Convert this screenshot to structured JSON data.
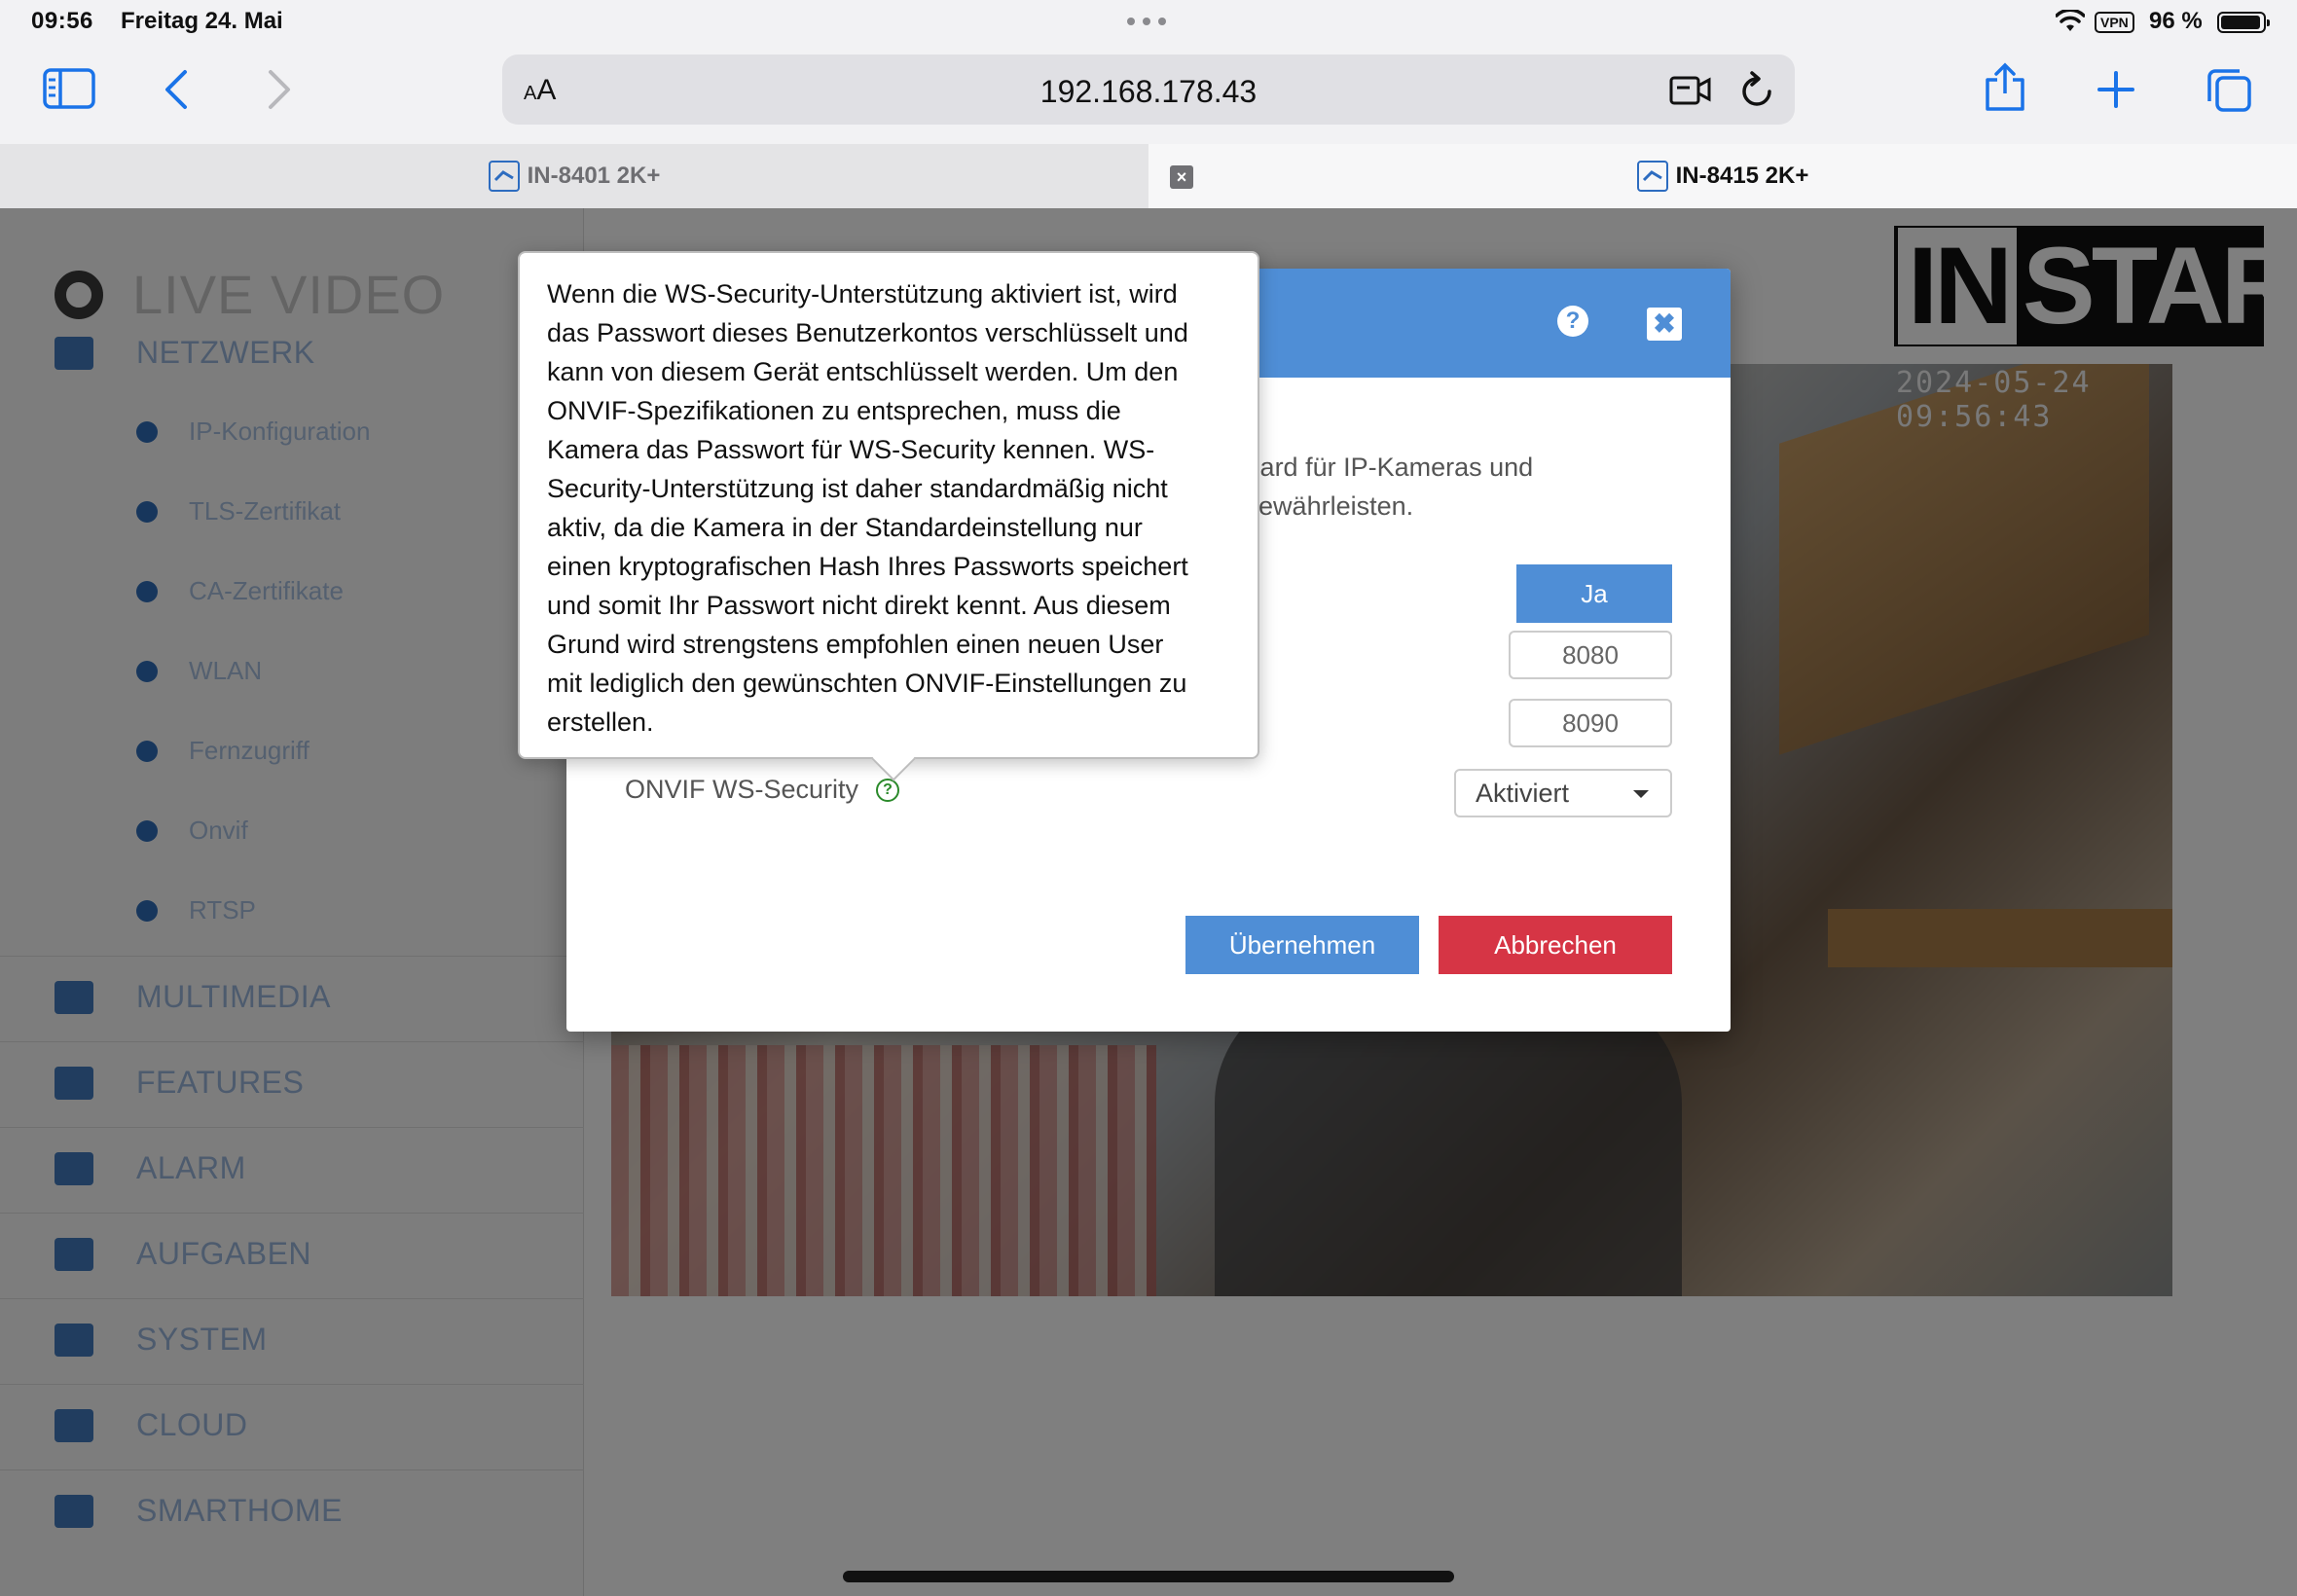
{
  "status_bar": {
    "time": "09:56",
    "date": "Freitag 24. Mai",
    "vpn": "VPN",
    "battery_percent": "96 %",
    "battery_level": 0.96
  },
  "toolbar": {
    "reader_label_small": "A",
    "reader_label_big": "A",
    "url": "192.168.178.43"
  },
  "tabs": [
    {
      "title": "IN-8401 2K+",
      "active": false
    },
    {
      "title": "IN-8415 2K+",
      "active": true
    }
  ],
  "sidebar": {
    "live_video": "LIVE VIDEO",
    "items": [
      {
        "label": "NETZWERK",
        "type": "main",
        "icon": "network-icon"
      },
      {
        "label": "IP-Konfiguration",
        "type": "sub",
        "icon": "dot-icon"
      },
      {
        "label": "TLS-Zertifikat",
        "type": "sub",
        "icon": "dot-icon"
      },
      {
        "label": "CA-Zertifikate",
        "type": "sub",
        "icon": "dot-icon"
      },
      {
        "label": "WLAN",
        "type": "sub",
        "icon": "wifi-icon"
      },
      {
        "label": "Fernzugriff",
        "type": "sub",
        "icon": "remote-icon"
      },
      {
        "label": "Onvif",
        "type": "sub",
        "icon": "onvif-icon"
      },
      {
        "label": "RTSP",
        "type": "sub",
        "icon": "rtsp-icon"
      },
      {
        "label": "MULTIMEDIA",
        "type": "main",
        "icon": "image-icon"
      },
      {
        "label": "FEATURES",
        "type": "main",
        "icon": "features-icon"
      },
      {
        "label": "ALARM",
        "type": "main",
        "icon": "bell-icon"
      },
      {
        "label": "AUFGABEN",
        "type": "main",
        "icon": "film-icon"
      },
      {
        "label": "SYSTEM",
        "type": "main",
        "icon": "gear-icon"
      },
      {
        "label": "CLOUD",
        "type": "main",
        "icon": "cloud-icon"
      },
      {
        "label": "SMARTHOME",
        "type": "main",
        "icon": "smarthome-icon"
      }
    ]
  },
  "video": {
    "timestamp": "2024-05-24 09:56:43",
    "logo_in": "IN",
    "logo_star": "STAR"
  },
  "modal": {
    "description_line1": "tandard für IP-Kameras und",
    "description_line2": "zu gewährleisten.",
    "toggle_value": "Ja",
    "port1": "8080",
    "port2": "8090",
    "ws_security_label": "ONVIF WS-Security",
    "ws_security_value": "Aktiviert",
    "apply_button": "Übernehmen",
    "cancel_button": "Abbrechen",
    "help_symbol": "?",
    "close_symbol": "✖"
  },
  "tooltip": {
    "text": "Wenn die WS-Security-Unterstützung aktiviert ist, wird\ndas Passwort dieses Benutzerkontos verschlüsselt und\nkann von diesem Gerät entschlüsselt werden. Um den\nONVIF-Spezifikationen zu entsprechen, muss die\nKamera das Passwort für WS-Security kennen. WS-\nSecurity-Unterstützung ist daher standardmäßig nicht\naktiv, da die Kamera in der Standardeinstellung nur\neinen kryptografischen Hash Ihres Passworts speichert\nund somit Ihr Passwort nicht direkt kennt. Aus diesem\nGrund wird strengstens empfohlen einen neuen User\nmit lediglich den gewünschten ONVIF-Einstellungen zu\nerstellen."
  },
  "colors": {
    "accent_blue": "#4f8ed6",
    "danger_red": "#d63545",
    "help_green": "#2b8a2b"
  }
}
